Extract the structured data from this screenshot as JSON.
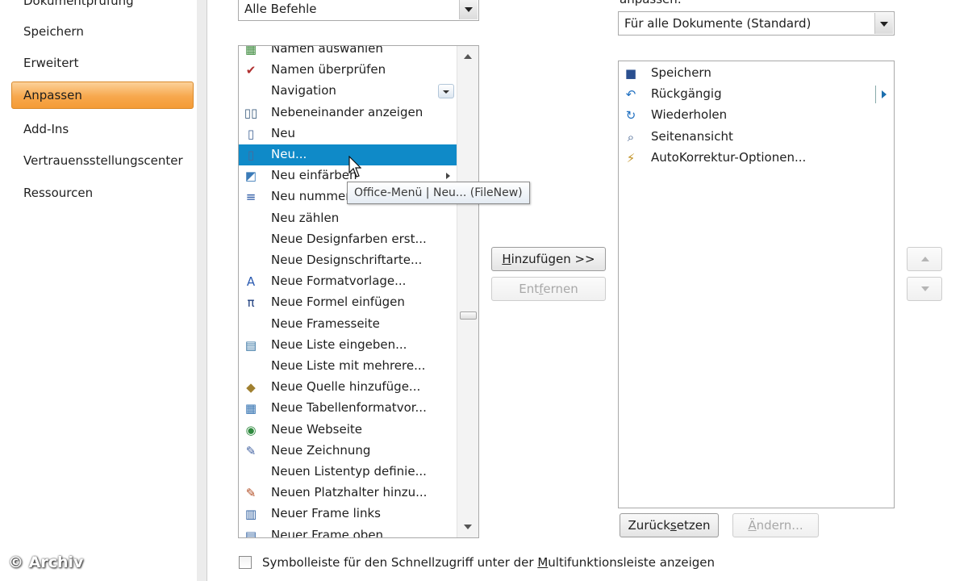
{
  "nav": {
    "items": [
      "Dokumentprüfung",
      "Speichern",
      "Erweitert",
      "Anpassen",
      "Add-Ins",
      "Vertrauensstellungscenter",
      "Ressourcen"
    ],
    "active_index": 3
  },
  "watermark": "© Archiv",
  "left_combo": {
    "value": "Alle Befehle"
  },
  "right_label": "anpassen:",
  "right_combo": {
    "value": "Für alle Dokumente (Standard)"
  },
  "commands": [
    {
      "label": "Namen auswählen",
      "icon": "names-icon"
    },
    {
      "label": "Namen überprüfen",
      "icon": "check-names-icon"
    },
    {
      "label": "Navigation",
      "icon": ""
    },
    {
      "label": "Nebeneinander anzeigen",
      "icon": "side-by-side-icon"
    },
    {
      "label": "Neu",
      "icon": "new-document-icon"
    },
    {
      "label": "Neu...",
      "icon": "new-document-icon"
    },
    {
      "label": "Neu einfärben",
      "icon": "recolor-icon"
    },
    {
      "label": "Neu nummerieren",
      "icon": "numbering-icon"
    },
    {
      "label": "Neu zählen",
      "icon": ""
    },
    {
      "label": "Neue Designfarben erst...",
      "icon": ""
    },
    {
      "label": "Neue Designschriftarte...",
      "icon": ""
    },
    {
      "label": "Neue Formatvorlage...",
      "icon": "new-style-icon"
    },
    {
      "label": "Neue Formel einfügen",
      "icon": "pi-icon"
    },
    {
      "label": "Neue Framesseite",
      "icon": ""
    },
    {
      "label": "Neue Liste eingeben...",
      "icon": "list-entry-icon"
    },
    {
      "label": "Neue Liste mit mehrere...",
      "icon": ""
    },
    {
      "label": "Neue Quelle hinzufüge...",
      "icon": "source-icon"
    },
    {
      "label": "Neue Tabellenformatvor...",
      "icon": "table-style-icon"
    },
    {
      "label": "Neue Webseite",
      "icon": "web-page-icon"
    },
    {
      "label": "Neue Zeichnung",
      "icon": "drawing-icon"
    },
    {
      "label": "Neuen Listentyp definie...",
      "icon": ""
    },
    {
      "label": "Neuen Platzhalter hinzu...",
      "icon": "placeholder-icon"
    },
    {
      "label": "Neuer Frame links",
      "icon": "frame-left-icon"
    },
    {
      "label": "Neuer Frame oben",
      "icon": "frame-top-icon"
    }
  ],
  "selected_command_index": 5,
  "tooltip": "Office-Menü | Neu... (FileNew)",
  "add_button": {
    "pre": "",
    "u": "H",
    "post": "inzufügen >>"
  },
  "remove_button": {
    "pre": "Ent",
    "u": "f",
    "post": "ernen"
  },
  "quick_access": [
    {
      "label": "Speichern",
      "icon": "save-icon"
    },
    {
      "label": "Rückgängig",
      "icon": "undo-icon"
    },
    {
      "label": "Wiederholen",
      "icon": "redo-icon"
    },
    {
      "label": "Seitenansicht",
      "icon": "print-preview-icon"
    },
    {
      "label": "AutoKorrektur-Optionen...",
      "icon": "autocorrect-icon"
    }
  ],
  "reset_button": {
    "pre": "Zurück",
    "u": "s",
    "post": "etzen"
  },
  "modify_button": {
    "pre": "",
    "u": "Ä",
    "post": "ndern..."
  },
  "checkbox": {
    "pre": "Symbolleiste für den Schnellzugriff unter der ",
    "u": "M",
    "post": "ultifunktionsleiste anzeigen",
    "checked": false
  },
  "colors": {
    "selection": "#0f8ac8",
    "active_nav": "#f7a84d"
  }
}
